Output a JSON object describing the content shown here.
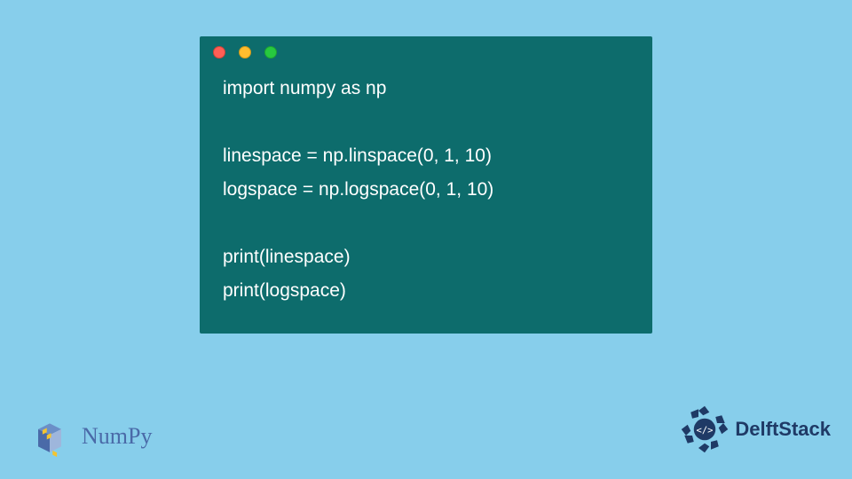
{
  "code": {
    "lines": [
      "import numpy as np",
      "",
      "linespace = np.linspace(0, 1, 10)",
      "logspace = np.logspace(0, 1, 10)",
      "",
      "print(linespace)",
      "print(logspace)"
    ]
  },
  "badges": {
    "numpy_label": "NumPy",
    "delftstack_label": "DelftStack",
    "delftstack_code": "</>"
  },
  "dots": {
    "red": "#ff5f56",
    "yellow": "#ffbd2e",
    "green": "#27c93f"
  }
}
